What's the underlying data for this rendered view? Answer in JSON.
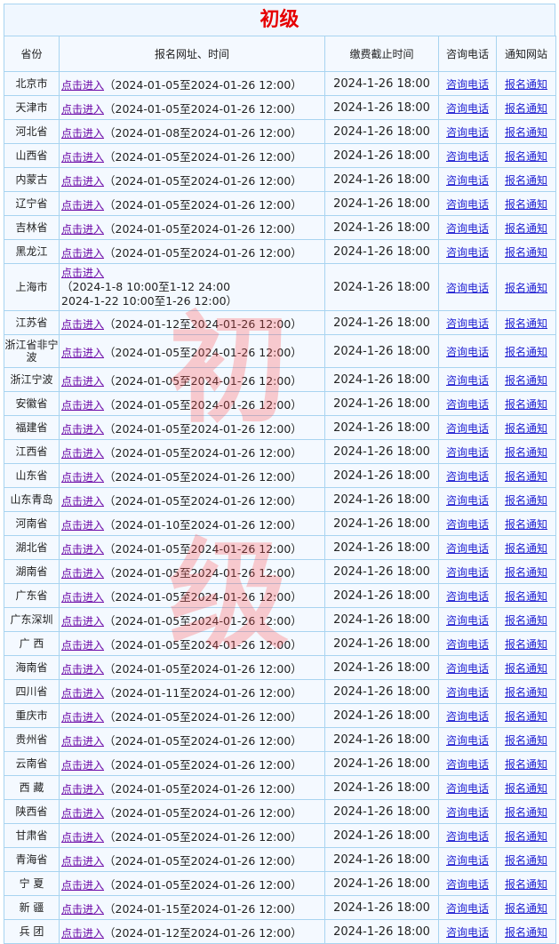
{
  "title": "初级",
  "headers": [
    "省份",
    "报名网址、时间",
    "缴费截止时间",
    "咨询电话",
    "通知网站"
  ],
  "watermark": [
    "初",
    "级"
  ],
  "link_label": "点击进入",
  "phone_label": "咨询电话",
  "notice_label": "报名通知",
  "rows": [
    {
      "province": "北京市",
      "period": "（2024-01-05至2024-01-26 12:00）",
      "deadline": "2024-1-26 18:00"
    },
    {
      "province": "天津市",
      "period": "（2024-01-05至2024-01-26 12:00）",
      "deadline": "2024-1-26 18:00"
    },
    {
      "province": "河北省",
      "period": "（2024-01-08至2024-01-26 12:00）",
      "deadline": "2024-1-26 18:00"
    },
    {
      "province": "山西省",
      "period": "（2024-01-05至2024-01-26 12:00）",
      "deadline": "2024-1-26 18:00"
    },
    {
      "province": "内蒙古",
      "period": "（2024-01-05至2024-01-26 12:00）",
      "deadline": "2024-1-26 18:00"
    },
    {
      "province": "辽宁省",
      "period": "（2024-01-05至2024-01-26 12:00）",
      "deadline": "2024-1-26 18:00"
    },
    {
      "province": "吉林省",
      "period": "（2024-01-05至2024-01-26 12:00）",
      "deadline": "2024-1-26 18:00"
    },
    {
      "province": "黑龙江",
      "period": "（2024-01-05至2024-01-26 12:00）",
      "deadline": "2024-1-26 18:00"
    },
    {
      "province": "上海市",
      "period_lines": [
        "（2024-1-8 10:00至1-12 24:00",
        "2024-1-22 10:00至1-26 12:00）"
      ],
      "deadline": "2024-1-26 18:00"
    },
    {
      "province": "江苏省",
      "period": "（2024-01-12至2024-01-26 12:00）",
      "deadline": "2024-1-26 18:00"
    },
    {
      "province": "浙江省非宁波",
      "period": "（2024-01-05至2024-01-26 12:00）",
      "deadline": "2024-1-26 18:00"
    },
    {
      "province": "浙江宁波",
      "period": "（2024-01-05至2024-01-26 12:00）",
      "deadline": "2024-1-26 18:00"
    },
    {
      "province": "安徽省",
      "period": "（2024-01-05至2024-01-26 12:00）",
      "deadline": "2024-1-26 18:00"
    },
    {
      "province": "福建省",
      "period": "（2024-01-05至2024-01-26 12:00）",
      "deadline": "2024-1-26 18:00"
    },
    {
      "province": "江西省",
      "period": "（2024-01-05至2024-01-26 12:00）",
      "deadline": "2024-1-26 18:00"
    },
    {
      "province": "山东省",
      "period": "（2024-01-05至2024-01-26 12:00）",
      "deadline": "2024-1-26 18:00"
    },
    {
      "province": "山东青岛",
      "period": "（2024-01-05至2024-01-26 12:00）",
      "deadline": "2024-1-26 18:00"
    },
    {
      "province": "河南省",
      "period": "（2024-01-10至2024-01-26 12:00）",
      "deadline": "2024-1-26 18:00"
    },
    {
      "province": "湖北省",
      "period": "（2024-01-05至2024-01-26 12:00）",
      "deadline": "2024-1-26 18:00"
    },
    {
      "province": "湖南省",
      "period": "（2024-01-05至2024-01-26 12:00）",
      "deadline": "2024-1-26 18:00"
    },
    {
      "province": "广东省",
      "period": "（2024-01-05至2024-01-26 12:00）",
      "deadline": "2024-1-26 18:00"
    },
    {
      "province": "广东深圳",
      "period": "（2024-01-05至2024-01-26 12:00）",
      "deadline": "2024-1-26 18:00"
    },
    {
      "province": "广 西",
      "period": "（2024-01-05至2024-01-26 12:00）",
      "deadline": "2024-1-26 18:00"
    },
    {
      "province": "海南省",
      "period": "（2024-01-05至2024-01-26 12:00）",
      "deadline": "2024-1-26 18:00"
    },
    {
      "province": "四川省",
      "period": "（2024-01-11至2024-01-26 12:00）",
      "deadline": "2024-1-26 18:00"
    },
    {
      "province": "重庆市",
      "period": "（2024-01-05至2024-01-26 12:00）",
      "deadline": "2024-1-26 18:00"
    },
    {
      "province": "贵州省",
      "period": "（2024-01-05至2024-01-26 12:00）",
      "deadline": "2024-1-26 18:00"
    },
    {
      "province": "云南省",
      "period": "（2024-01-05至2024-01-26 12:00）",
      "deadline": "2024-1-26 18:00"
    },
    {
      "province": "西 藏",
      "period": "（2024-01-05至2024-01-26 12:00）",
      "deadline": "2024-1-26 18:00"
    },
    {
      "province": "陕西省",
      "period": "（2024-01-05至2024-01-26 12:00）",
      "deadline": "2024-1-26 18:00"
    },
    {
      "province": "甘肃省",
      "period": "（2024-01-05至2024-01-26 12:00）",
      "deadline": "2024-1-26 18:00"
    },
    {
      "province": "青海省",
      "period": "（2024-01-05至2024-01-26 12:00）",
      "deadline": "2024-1-26 18:00"
    },
    {
      "province": "宁 夏",
      "period": "（2024-01-05至2024-01-26 12:00）",
      "deadline": "2024-1-26 18:00"
    },
    {
      "province": "新 疆",
      "period": "（2024-01-15至2024-01-26 12:00）",
      "deadline": "2024-1-26 18:00"
    },
    {
      "province": "兵 团",
      "period": "（2024-01-12至2024-01-26 12:00）",
      "deadline": "2024-1-26 18:00"
    }
  ]
}
